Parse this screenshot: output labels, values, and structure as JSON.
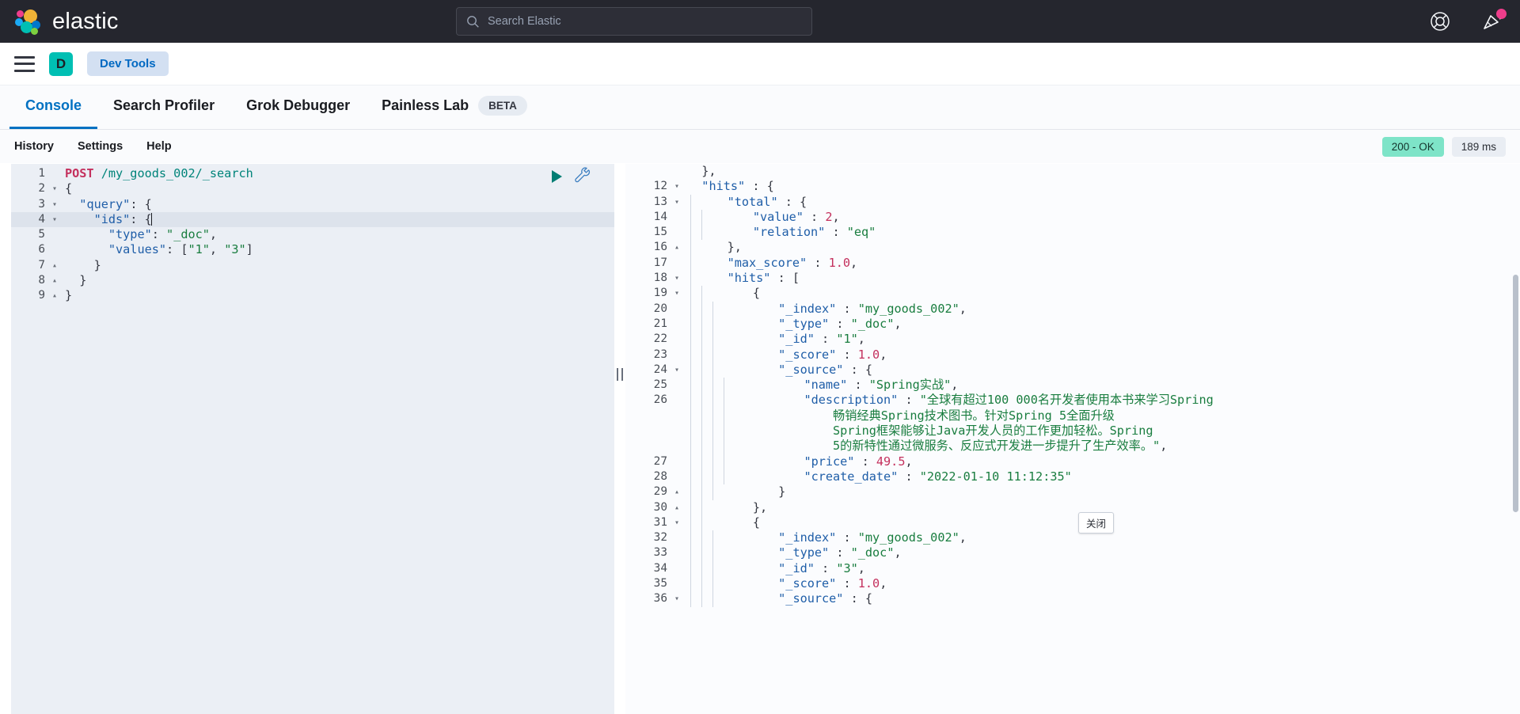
{
  "header": {
    "brand": "elastic",
    "search_placeholder": "Search Elastic",
    "help_icon": "lifebuoy-icon",
    "announcements_icon": "megaphone-icon"
  },
  "navbar": {
    "menu_icon": "hamburger-menu-icon",
    "space_initial": "D",
    "breadcrumb": "Dev Tools"
  },
  "tabs": [
    {
      "label": "Console",
      "active": true,
      "badge": ""
    },
    {
      "label": "Search Profiler",
      "active": false,
      "badge": ""
    },
    {
      "label": "Grok Debugger",
      "active": false,
      "badge": ""
    },
    {
      "label": "Painless Lab",
      "active": false,
      "badge": "BETA"
    }
  ],
  "subbar": {
    "history": "History",
    "settings": "Settings",
    "help": "Help",
    "status_code": "200 - OK",
    "duration": "189 ms",
    "status_color": "#7ee4c8"
  },
  "editor": {
    "run_icon": "play-icon",
    "wrench_icon": "wrench-icon",
    "highlighted_line": 4,
    "lines": [
      {
        "n": 1,
        "fold": "",
        "parts": [
          {
            "t": "method",
            "v": "POST"
          },
          {
            "t": "sp",
            "v": " "
          },
          {
            "t": "path",
            "v": "/my_goods_002/_search"
          }
        ]
      },
      {
        "n": 2,
        "fold": "▾",
        "parts": [
          {
            "t": "punct",
            "v": "{"
          }
        ]
      },
      {
        "n": 3,
        "fold": "▾",
        "parts": [
          {
            "t": "punct",
            "v": "  "
          },
          {
            "t": "key",
            "v": "\"query\""
          },
          {
            "t": "punct",
            "v": ": {"
          }
        ]
      },
      {
        "n": 4,
        "fold": "▾",
        "parts": [
          {
            "t": "punct",
            "v": "    "
          },
          {
            "t": "key",
            "v": "\"ids\""
          },
          {
            "t": "punct",
            "v": ": {"
          },
          {
            "t": "caret",
            "v": ""
          }
        ]
      },
      {
        "n": 5,
        "fold": "",
        "parts": [
          {
            "t": "punct",
            "v": "      "
          },
          {
            "t": "key",
            "v": "\"type\""
          },
          {
            "t": "punct",
            "v": ": "
          },
          {
            "t": "str",
            "v": "\"_doc\""
          },
          {
            "t": "punct",
            "v": ","
          }
        ]
      },
      {
        "n": 6,
        "fold": "",
        "parts": [
          {
            "t": "punct",
            "v": "      "
          },
          {
            "t": "key",
            "v": "\"values\""
          },
          {
            "t": "punct",
            "v": ": ["
          },
          {
            "t": "str",
            "v": "\"1\""
          },
          {
            "t": "punct",
            "v": ", "
          },
          {
            "t": "str",
            "v": "\"3\""
          },
          {
            "t": "punct",
            "v": "]"
          }
        ]
      },
      {
        "n": 7,
        "fold": "▴",
        "parts": [
          {
            "t": "punct",
            "v": "    }"
          }
        ]
      },
      {
        "n": 8,
        "fold": "▴",
        "parts": [
          {
            "t": "punct",
            "v": "  }"
          }
        ]
      },
      {
        "n": 9,
        "fold": "▴",
        "parts": [
          {
            "t": "punct",
            "v": "}"
          }
        ]
      }
    ]
  },
  "response": {
    "close_tooltip": "关闭",
    "lines": [
      {
        "n": "",
        "fold": "",
        "bars": 0,
        "parts": [
          {
            "t": "punct",
            "v": "  },"
          }
        ]
      },
      {
        "n": "12",
        "fold": "▾",
        "bars": 0,
        "parts": [
          {
            "t": "punct",
            "v": "  "
          },
          {
            "t": "key",
            "v": "\"hits\""
          },
          {
            "t": "punct",
            "v": " : {"
          }
        ]
      },
      {
        "n": "13",
        "fold": "▾",
        "bars": 1,
        "parts": [
          {
            "t": "punct",
            "v": "    "
          },
          {
            "t": "key",
            "v": "\"total\""
          },
          {
            "t": "punct",
            "v": " : {"
          }
        ]
      },
      {
        "n": "14",
        "fold": "",
        "bars": 2,
        "parts": [
          {
            "t": "punct",
            "v": "      "
          },
          {
            "t": "key",
            "v": "\"value\""
          },
          {
            "t": "punct",
            "v": " : "
          },
          {
            "t": "num",
            "v": "2"
          },
          {
            "t": "punct",
            "v": ","
          }
        ]
      },
      {
        "n": "15",
        "fold": "",
        "bars": 2,
        "parts": [
          {
            "t": "punct",
            "v": "      "
          },
          {
            "t": "key",
            "v": "\"relation\""
          },
          {
            "t": "punct",
            "v": " : "
          },
          {
            "t": "str",
            "v": "\"eq\""
          }
        ]
      },
      {
        "n": "16",
        "fold": "▴",
        "bars": 1,
        "parts": [
          {
            "t": "punct",
            "v": "    },"
          }
        ]
      },
      {
        "n": "17",
        "fold": "",
        "bars": 1,
        "parts": [
          {
            "t": "punct",
            "v": "    "
          },
          {
            "t": "key",
            "v": "\"max_score\""
          },
          {
            "t": "punct",
            "v": " : "
          },
          {
            "t": "num",
            "v": "1.0"
          },
          {
            "t": "punct",
            "v": ","
          }
        ]
      },
      {
        "n": "18",
        "fold": "▾",
        "bars": 1,
        "parts": [
          {
            "t": "punct",
            "v": "    "
          },
          {
            "t": "key",
            "v": "\"hits\""
          },
          {
            "t": "punct",
            "v": " : ["
          }
        ]
      },
      {
        "n": "19",
        "fold": "▾",
        "bars": 2,
        "parts": [
          {
            "t": "punct",
            "v": "      {"
          }
        ]
      },
      {
        "n": "20",
        "fold": "",
        "bars": 3,
        "parts": [
          {
            "t": "punct",
            "v": "        "
          },
          {
            "t": "key",
            "v": "\"_index\""
          },
          {
            "t": "punct",
            "v": " : "
          },
          {
            "t": "str",
            "v": "\"my_goods_002\""
          },
          {
            "t": "punct",
            "v": ","
          }
        ]
      },
      {
        "n": "21",
        "fold": "",
        "bars": 3,
        "parts": [
          {
            "t": "punct",
            "v": "        "
          },
          {
            "t": "key",
            "v": "\"_type\""
          },
          {
            "t": "punct",
            "v": " : "
          },
          {
            "t": "str",
            "v": "\"_doc\""
          },
          {
            "t": "punct",
            "v": ","
          }
        ]
      },
      {
        "n": "22",
        "fold": "",
        "bars": 3,
        "parts": [
          {
            "t": "punct",
            "v": "        "
          },
          {
            "t": "key",
            "v": "\"_id\""
          },
          {
            "t": "punct",
            "v": " : "
          },
          {
            "t": "str",
            "v": "\"1\""
          },
          {
            "t": "punct",
            "v": ","
          }
        ]
      },
      {
        "n": "23",
        "fold": "",
        "bars": 3,
        "parts": [
          {
            "t": "punct",
            "v": "        "
          },
          {
            "t": "key",
            "v": "\"_score\""
          },
          {
            "t": "punct",
            "v": " : "
          },
          {
            "t": "num",
            "v": "1.0"
          },
          {
            "t": "punct",
            "v": ","
          }
        ]
      },
      {
        "n": "24",
        "fold": "▾",
        "bars": 3,
        "parts": [
          {
            "t": "punct",
            "v": "        "
          },
          {
            "t": "key",
            "v": "\"_source\""
          },
          {
            "t": "punct",
            "v": " : {"
          }
        ]
      },
      {
        "n": "25",
        "fold": "",
        "bars": 4,
        "parts": [
          {
            "t": "punct",
            "v": "          "
          },
          {
            "t": "key",
            "v": "\"name\""
          },
          {
            "t": "punct",
            "v": " : "
          },
          {
            "t": "str",
            "v": "\"Spring实战\""
          },
          {
            "t": "punct",
            "v": ","
          }
        ]
      },
      {
        "n": "26",
        "fold": "",
        "bars": 4,
        "tall": true,
        "parts": [
          {
            "t": "punct",
            "v": "          "
          },
          {
            "t": "key",
            "v": "\"description\""
          },
          {
            "t": "punct",
            "v": " : "
          },
          {
            "t": "str",
            "v": "\"全球有超过100 000名开发者使用本书来学习Spring\n              畅销经典Spring技术图书。针对Spring 5全面升级\n              Spring框架能够让Java开发人员的工作更加轻松。Spring\n              5的新特性通过微服务、反应式开发进一步提升了生产效率。\""
          },
          {
            "t": "punct",
            "v": ","
          }
        ]
      },
      {
        "n": "27",
        "fold": "",
        "bars": 4,
        "parts": [
          {
            "t": "punct",
            "v": "          "
          },
          {
            "t": "key",
            "v": "\"price\""
          },
          {
            "t": "punct",
            "v": " : "
          },
          {
            "t": "num",
            "v": "49.5"
          },
          {
            "t": "punct",
            "v": ","
          }
        ]
      },
      {
        "n": "28",
        "fold": "",
        "bars": 4,
        "parts": [
          {
            "t": "punct",
            "v": "          "
          },
          {
            "t": "key",
            "v": "\"create_date\""
          },
          {
            "t": "punct",
            "v": " : "
          },
          {
            "t": "str",
            "v": "\"2022-01-10 11:12:35\""
          }
        ]
      },
      {
        "n": "29",
        "fold": "▴",
        "bars": 3,
        "parts": [
          {
            "t": "punct",
            "v": "        }"
          }
        ]
      },
      {
        "n": "30",
        "fold": "▴",
        "bars": 2,
        "parts": [
          {
            "t": "punct",
            "v": "      },"
          }
        ]
      },
      {
        "n": "31",
        "fold": "▾",
        "bars": 2,
        "parts": [
          {
            "t": "punct",
            "v": "      {"
          }
        ]
      },
      {
        "n": "32",
        "fold": "",
        "bars": 3,
        "parts": [
          {
            "t": "punct",
            "v": "        "
          },
          {
            "t": "key",
            "v": "\"_index\""
          },
          {
            "t": "punct",
            "v": " : "
          },
          {
            "t": "str",
            "v": "\"my_goods_002\""
          },
          {
            "t": "punct",
            "v": ","
          }
        ]
      },
      {
        "n": "33",
        "fold": "",
        "bars": 3,
        "parts": [
          {
            "t": "punct",
            "v": "        "
          },
          {
            "t": "key",
            "v": "\"_type\""
          },
          {
            "t": "punct",
            "v": " : "
          },
          {
            "t": "str",
            "v": "\"_doc\""
          },
          {
            "t": "punct",
            "v": ","
          }
        ]
      },
      {
        "n": "34",
        "fold": "",
        "bars": 3,
        "parts": [
          {
            "t": "punct",
            "v": "        "
          },
          {
            "t": "key",
            "v": "\"_id\""
          },
          {
            "t": "punct",
            "v": " : "
          },
          {
            "t": "str",
            "v": "\"3\""
          },
          {
            "t": "punct",
            "v": ","
          }
        ]
      },
      {
        "n": "35",
        "fold": "",
        "bars": 3,
        "parts": [
          {
            "t": "punct",
            "v": "        "
          },
          {
            "t": "key",
            "v": "\"_score\""
          },
          {
            "t": "punct",
            "v": " : "
          },
          {
            "t": "num",
            "v": "1.0"
          },
          {
            "t": "punct",
            "v": ","
          }
        ]
      },
      {
        "n": "36",
        "fold": "▾",
        "bars": 3,
        "parts": [
          {
            "t": "punct",
            "v": "        "
          },
          {
            "t": "key",
            "v": "\"_source\""
          },
          {
            "t": "punct",
            "v": " : {"
          }
        ]
      }
    ]
  }
}
